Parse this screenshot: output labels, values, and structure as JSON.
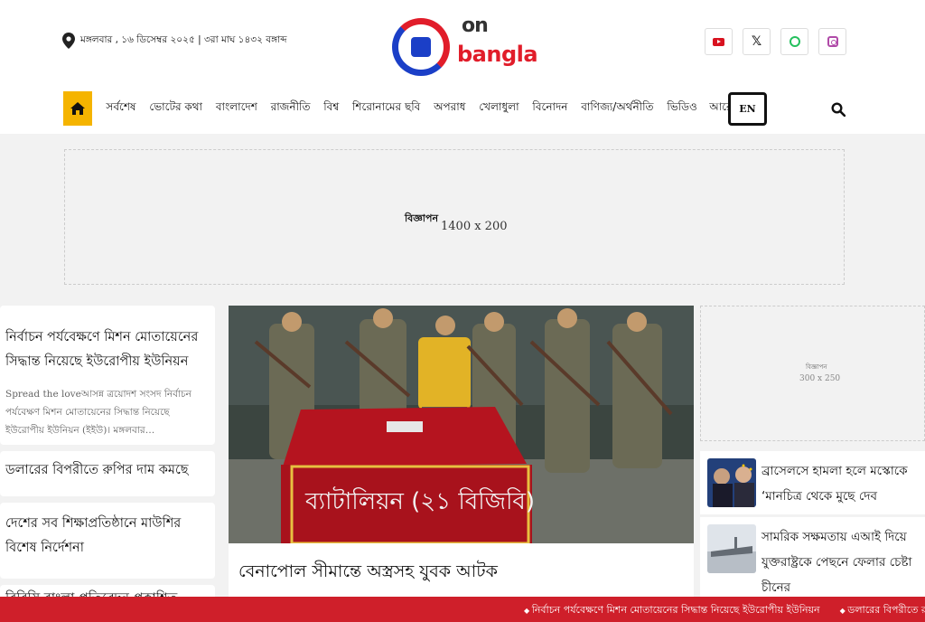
{
  "header": {
    "date_text": "মঙ্গলবার , ১৬ ডিসেম্বর ২০২৫ | ৩রা মাঘ ১৪৩২ বঙ্গাব্দ",
    "logo": {
      "line1": "on",
      "line2": "bangla"
    },
    "socials": [
      {
        "name": "youtube-icon",
        "glyph": ""
      },
      {
        "name": "x-icon",
        "glyph": "𝕏"
      },
      {
        "name": "whatsapp-icon",
        "glyph": ""
      },
      {
        "name": "instagram-icon",
        "glyph": ""
      }
    ]
  },
  "nav": {
    "items": [
      "সর্বশেষ",
      "ভোটের কথা",
      "বাংলাদেশ",
      "রাজনীতি",
      "বিশ্ব",
      "শিরোনামের ছবি",
      "অপরাধ",
      "খেলাধুলা",
      "বিনোদন",
      "বাণিজ্য/অর্থনীতি",
      "ভিডিও"
    ],
    "more_label": "আরো",
    "lang_button": "EN"
  },
  "ad_banner": {
    "label": "বিজ্ঞাপন",
    "size": "1400 x 200"
  },
  "left_column": [
    {
      "title": "নির্বাচন পর্যবেক্ষণে মিশন মোতায়েনের সিদ্ধান্ত নিয়েছে ইউরোপীয় ইউনিয়ন",
      "excerpt": "Spread the loveআসন্ন ত্রয়োদশ সংসদ নির্বাচন পর্যবেক্ষণ মিশন মোতায়েনের সিদ্ধান্ত নিয়েছে ইউরোপীয় ইউনিয়ন (ইইউ)। মঙ্গলবার…"
    },
    {
      "title": "ডলারের বিপরীতে রুপির দাম কমছে"
    },
    {
      "title": "দেশের সব শিক্ষাপ্রতিষ্ঠানে মাউশির বিশেষ নির্দেশনা"
    },
    {
      "title": "বিবিসি বাংলা প্রতিবেদন প্রকাশিত"
    }
  ],
  "main_story": {
    "title": "বেনাপোল সীমান্তে অস্ত্রসহ যুবক আটক",
    "banner_text": "ব্যাটালিয়ন (২১ বিজিবি)"
  },
  "right_column": {
    "ad": {
      "label": "বিজ্ঞাপন",
      "size": "300 x 250"
    },
    "items": [
      {
        "title": "ব্রাসেলসে হামলা হলে মস্কোকে ‘মানচিত্র থেকে মুছে দেব"
      },
      {
        "title": "সামরিক সক্ষমতায় এআই দিয়ে যুক্তরাষ্ট্রকে পেছনে ফেলার চেষ্টা চীনের"
      }
    ]
  },
  "ticker": {
    "items": [
      "নির্বাচন পর্যবেক্ষণে মিশন মোতায়েনের সিদ্ধান্ত নিয়েছে ইউরোপীয় ইউনিয়ন",
      "ডলারের বিপরীতে রুপির দাম কমছে"
    ]
  },
  "colors": {
    "accent_yellow": "#f5b400",
    "brand_red": "#e11d2a",
    "brand_blue": "#1b3fc7",
    "ticker_red": "#cf1f2a"
  }
}
